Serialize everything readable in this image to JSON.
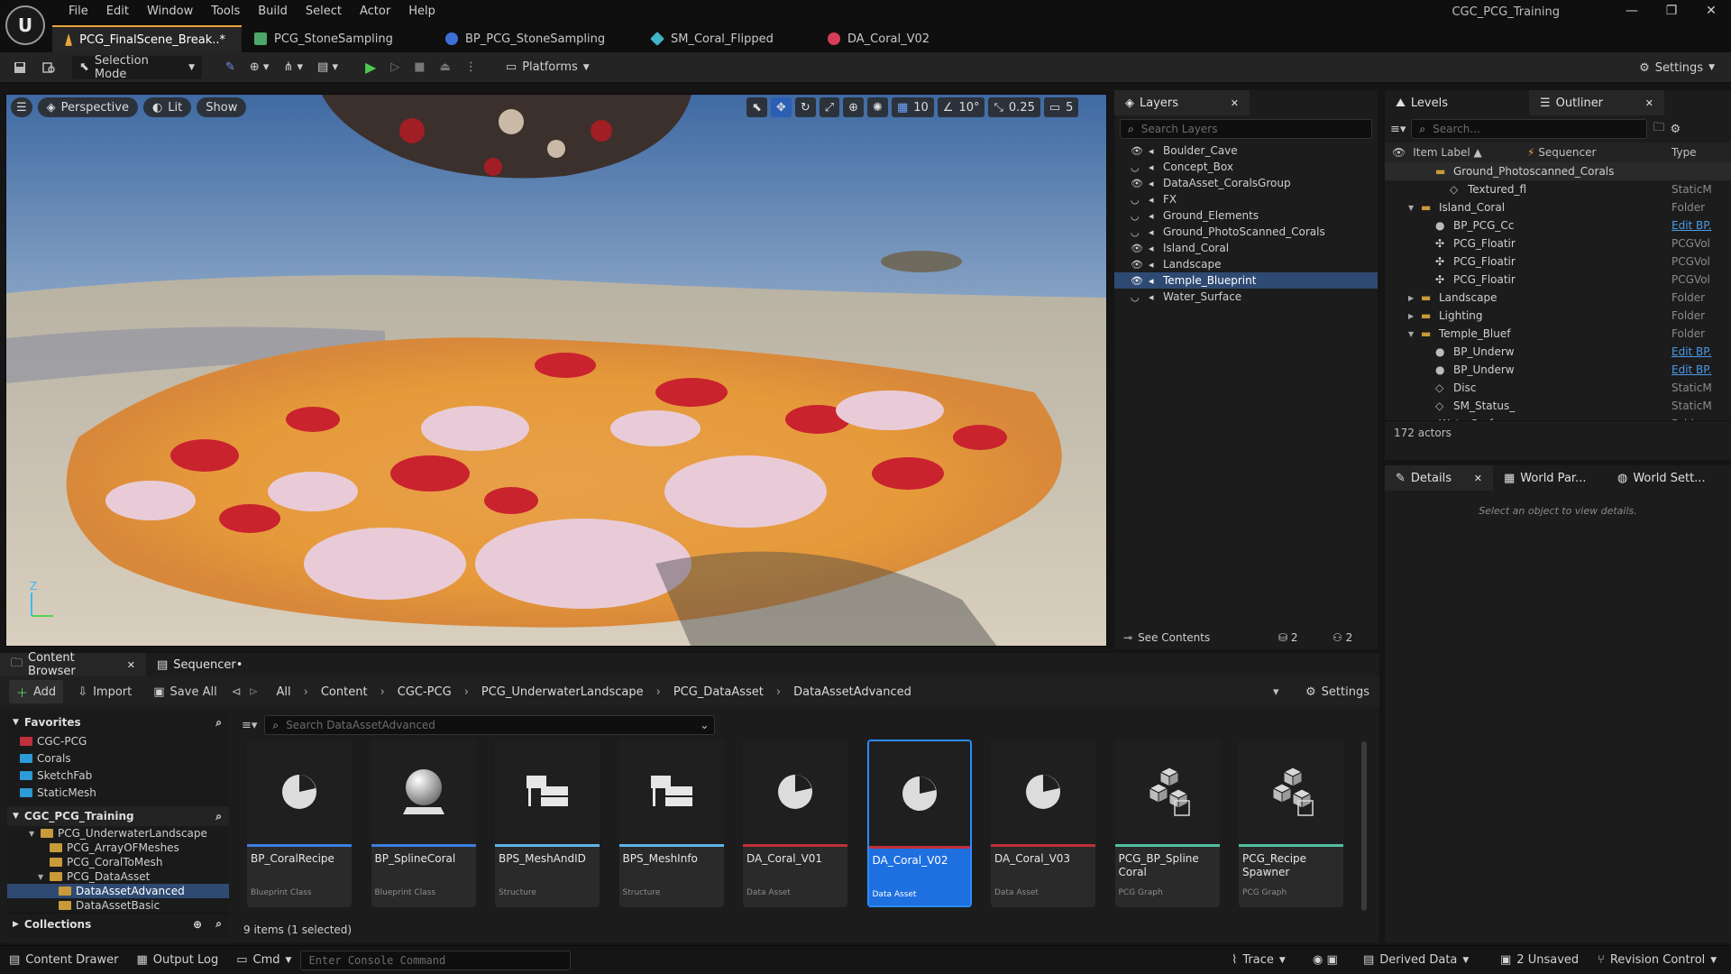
{
  "app": {
    "title": "CGC_PCG_Training"
  },
  "menu": [
    "File",
    "Edit",
    "Window",
    "Tools",
    "Build",
    "Select",
    "Actor",
    "Help"
  ],
  "doc_tabs": [
    {
      "label": "PCG_FinalScene_Break..*",
      "color": "#e8a33c"
    },
    {
      "label": "PCG_StoneSampling",
      "color": "#4ca86a"
    },
    {
      "label": "BP_PCG_StoneSampling",
      "color": "#3d6fd6"
    },
    {
      "label": "SM_Coral_Flipped",
      "color": "#3fb5c8"
    },
    {
      "label": "DA_Coral_V02",
      "color": "#d63d5a"
    }
  ],
  "toolbar": {
    "selection_mode": "Selection Mode",
    "platforms": "Platforms",
    "settings": "Settings"
  },
  "viewport": {
    "perspective": "Perspective",
    "lit": "Lit",
    "show": "Show",
    "grid": "10",
    "angle": "10°",
    "scale": "0.25",
    "camera_speed": "5",
    "axis_z": "Z"
  },
  "layers": {
    "title": "Layers",
    "search_placeholder": "Search Layers",
    "items": [
      "Boulder_Cave",
      "Concept_Box",
      "DataAsset_CoralsGroup",
      "FX",
      "Ground_Elements",
      "Ground_PhotoScanned_Corals",
      "Island_Coral",
      "Landscape",
      "Temple_Blueprint",
      "Water_Surface"
    ],
    "selected": "Temple_Blueprint",
    "see_contents": "See Contents",
    "count_a": "2",
    "count_b": "2"
  },
  "outliner": {
    "tab_levels": "Levels",
    "tab_outliner": "Outliner",
    "search_placeholder": "Search...",
    "col_label": "Item Label ▲",
    "col_sequencer": "Sequencer",
    "col_type": "Type",
    "rows": [
      {
        "label": "Ground_Photoscanned_Corals",
        "type": "",
        "indent": 3,
        "kind": "folder"
      },
      {
        "label": "Textured_fl",
        "type": "StaticM",
        "indent": 4,
        "kind": "mesh"
      },
      {
        "label": "Island_Coral",
        "type": "Folder",
        "indent": 2,
        "kind": "folder-open"
      },
      {
        "label": "BP_PCG_Cc",
        "type": "Edit BP.",
        "indent": 3,
        "kind": "bp",
        "link": true
      },
      {
        "label": "PCG_Floatir",
        "type": "PCGVol",
        "indent": 3,
        "kind": "pcg"
      },
      {
        "label": "PCG_Floatir",
        "type": "PCGVol",
        "indent": 3,
        "kind": "pcg"
      },
      {
        "label": "PCG_Floatir",
        "type": "PCGVol",
        "indent": 3,
        "kind": "pcg"
      },
      {
        "label": "Landscape",
        "type": "Folder",
        "indent": 2,
        "kind": "folder"
      },
      {
        "label": "Lighting",
        "type": "Folder",
        "indent": 2,
        "kind": "folder"
      },
      {
        "label": "Temple_Bluef",
        "type": "Folder",
        "indent": 2,
        "kind": "folder-open"
      },
      {
        "label": "BP_Underw",
        "type": "Edit BP.",
        "indent": 3,
        "kind": "bp",
        "link": true
      },
      {
        "label": "BP_Underw",
        "type": "Edit BP.",
        "indent": 3,
        "kind": "bp",
        "link": true
      },
      {
        "label": "Disc",
        "type": "StaticM",
        "indent": 3,
        "kind": "mesh"
      },
      {
        "label": "SM_Status_",
        "type": "StaticM",
        "indent": 3,
        "kind": "mesh"
      },
      {
        "label": "WaterSurface",
        "type": "Folder",
        "indent": 2,
        "kind": "folder"
      }
    ],
    "actor_count": "172 actors"
  },
  "details": {
    "tab_details": "Details",
    "tab_world_par": "World Par...",
    "tab_world_sett": "World Sett...",
    "empty_msg": "Select an object to view details."
  },
  "content_browser": {
    "tab": "Content Browser",
    "tab_sequencer": "Sequencer•",
    "add": "Add",
    "import": "Import",
    "save_all": "Save All",
    "settings": "Settings",
    "path": [
      "All",
      "Content",
      "CGC-PCG",
      "PCG_UnderwaterLandscape",
      "PCG_DataAsset",
      "DataAssetAdvanced"
    ],
    "search_placeholder": "Search DataAssetAdvanced",
    "favorites_title": "Favorites",
    "favorites": [
      {
        "label": "CGC-PCG",
        "color": "#c0303a"
      },
      {
        "label": "Corals",
        "color": "#2c9bd6"
      },
      {
        "label": "SketchFab",
        "color": "#2c9bd6"
      },
      {
        "label": "StaticMesh",
        "color": "#2c9bd6"
      }
    ],
    "project_title": "CGC_PCG_Training",
    "tree": [
      {
        "label": "PCG_UnderwaterLandscape",
        "indent": 1,
        "open": true
      },
      {
        "label": "PCG_ArrayOFMeshes",
        "indent": 2
      },
      {
        "label": "PCG_CoralToMesh",
        "indent": 2
      },
      {
        "label": "PCG_DataAsset",
        "indent": 2,
        "open": true
      },
      {
        "label": "DataAssetAdvanced",
        "indent": 3,
        "selected": true
      },
      {
        "label": "DataAssetBasic",
        "indent": 3
      }
    ],
    "collections": "Collections",
    "assets": [
      {
        "name": "BP_CoralRecipe",
        "type": "Blueprint Class",
        "color": "#3d7fe0",
        "icon": "pie"
      },
      {
        "name": "BP_SplineCoral",
        "type": "Blueprint Class",
        "color": "#3d7fe0",
        "icon": "sphere"
      },
      {
        "name": "BPS_MeshAndID",
        "type": "Structure",
        "color": "#5bb6e6",
        "icon": "struct"
      },
      {
        "name": "BPS_MeshInfo",
        "type": "Structure",
        "color": "#5bb6e6",
        "icon": "struct"
      },
      {
        "name": "DA_Coral_V01",
        "type": "Data Asset",
        "color": "#c0303a",
        "icon": "pie"
      },
      {
        "name": "DA_Coral_V02",
        "type": "Data Asset",
        "color": "#c0303a",
        "icon": "pie",
        "selected": true
      },
      {
        "name": "DA_Coral_V03",
        "type": "Data Asset",
        "color": "#c0303a",
        "icon": "pie"
      },
      {
        "name": "PCG_BP_Spline Coral",
        "type": "PCG Graph",
        "color": "#4fbfa0",
        "icon": "cubes"
      },
      {
        "name": "PCG_Recipe Spawner",
        "type": "PCG Graph",
        "color": "#4fbfa0",
        "icon": "cubes"
      }
    ],
    "item_count": "9 items (1 selected)"
  },
  "statusbar": {
    "content_drawer": "Content Drawer",
    "output_log": "Output Log",
    "cmd": "Cmd",
    "console_placeholder": "Enter Console Command",
    "trace": "Trace",
    "derived_data": "Derived Data",
    "unsaved": "2 Unsaved",
    "revision_control": "Revision Control"
  }
}
